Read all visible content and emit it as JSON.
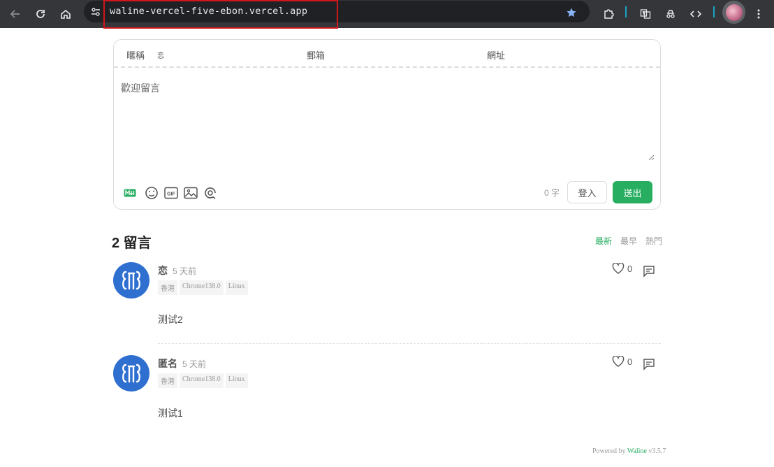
{
  "browser": {
    "url": "waline-vercel-five-ebon.vercel.app"
  },
  "editor": {
    "nick_label": "暱稱",
    "nick_value": "恋",
    "mail_label": "郵箱",
    "link_label": "網址",
    "placeholder": "歡迎留言",
    "word_count": "0 字",
    "login_label": "登入",
    "submit_label": "送出",
    "toolbar_icons": [
      "markdown-icon",
      "emoji-icon",
      "gif-icon",
      "image-icon",
      "preview-icon"
    ]
  },
  "comments_header": {
    "count_title": "2 留言",
    "sort_options": [
      "最新",
      "最早",
      "熱門"
    ],
    "active_sort": "最新"
  },
  "comments": [
    {
      "nick": "恋",
      "time": "5 天前",
      "meta": [
        "香港",
        "Chrome138.0",
        "Linux"
      ],
      "likes": "0",
      "content": "测试2"
    },
    {
      "nick": "匿名",
      "time": "5 天前",
      "meta": [
        "香港",
        "Chrome138.0",
        "Linux"
      ],
      "likes": "0",
      "content": "测试1"
    }
  ],
  "footer": {
    "powered_prefix": "Powered by ",
    "brand": "Waline",
    "version": " v3.5.7"
  },
  "colors": {
    "accent": "#27ae60",
    "toolbar_bg": "#35363a",
    "omnibox_bg": "#202124",
    "highlight": "#d1161b",
    "avatar_bg": "#2f6fd0"
  }
}
